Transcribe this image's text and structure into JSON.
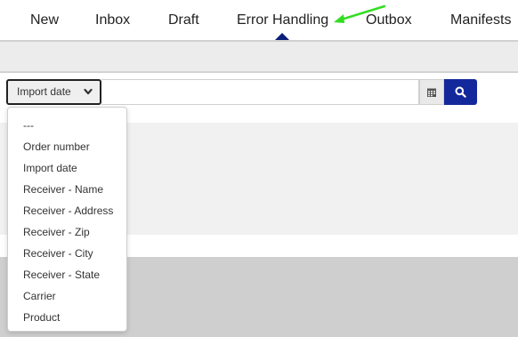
{
  "nav": {
    "tabs": [
      {
        "label": "New"
      },
      {
        "label": "Inbox"
      },
      {
        "label": "Draft"
      },
      {
        "label": "Error Handling",
        "active": true
      },
      {
        "label": "Outbox"
      },
      {
        "label": "Manifests"
      }
    ]
  },
  "search": {
    "field_label": "Import date",
    "value": "",
    "calendar_icon": "calendar-icon",
    "search_icon": "search-icon"
  },
  "dropdown": {
    "options": [
      "---",
      "Order number",
      "Import date",
      "Receiver - Name",
      "Receiver - Address",
      "Receiver - Zip",
      "Receiver - City",
      "Receiver - State",
      "Carrier",
      "Product"
    ]
  },
  "colors": {
    "accent": "#13299b",
    "annotation_arrow": "#33dd22"
  }
}
